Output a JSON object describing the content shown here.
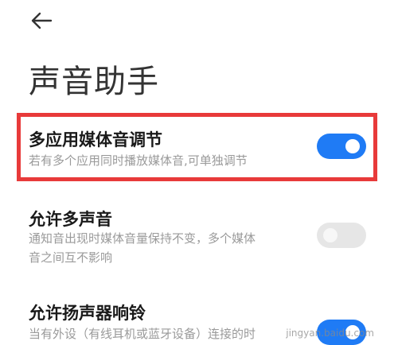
{
  "header": {
    "back_icon": "arrow-left-icon",
    "title": "声音助手"
  },
  "settings": [
    {
      "title": "多应用媒体音调节",
      "desc": "若有多个应用同时播放媒体音,可单独调节",
      "enabled": true
    },
    {
      "title": "允许多声音",
      "desc": "通知音出现时媒体音量保持不变，多个媒体\n音之间互不影响",
      "enabled": false
    },
    {
      "title": "允许扬声器响铃",
      "desc": "当有外设（有线耳机或蓝牙设备）连接的时",
      "enabled": true
    }
  ],
  "watermark": "jingyan.baidu.com",
  "colors": {
    "accent": "#1f7bf5",
    "highlight": "#e83a3a",
    "toggle_off": "#e6e6e6"
  }
}
